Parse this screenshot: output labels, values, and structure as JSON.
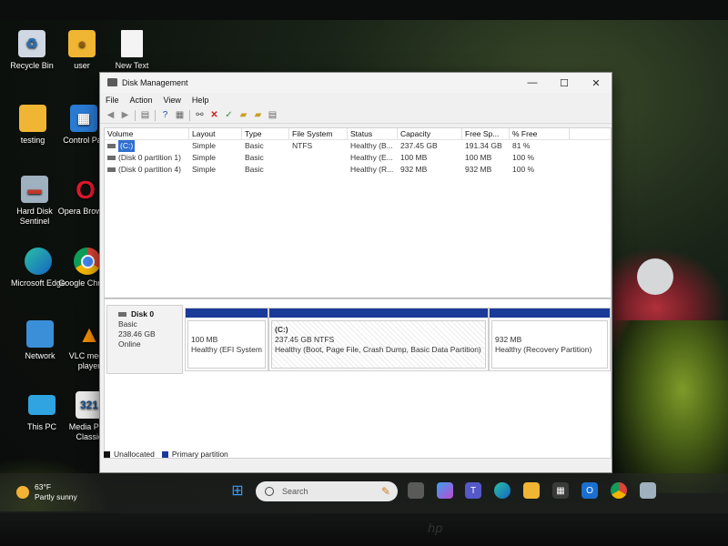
{
  "desktop": {
    "icons": [
      {
        "label": "Recycle Bin",
        "icon": "recycle-bin-icon"
      },
      {
        "label": "user",
        "icon": "folder-icon"
      },
      {
        "label": "New Text",
        "icon": "document-icon"
      },
      {
        "label": "testing",
        "icon": "folder-icon"
      },
      {
        "label": "Control Par",
        "icon": "control-panel-icon"
      },
      {
        "label": "Hard Disk Sentinel",
        "icon": "hard-disk-sentinel-icon"
      },
      {
        "label": "Opera Browser",
        "icon": "opera-icon"
      },
      {
        "label": "Microsoft Edge",
        "icon": "edge-icon"
      },
      {
        "label": "Google Chrome",
        "icon": "chrome-icon"
      },
      {
        "label": "Network",
        "icon": "network-icon"
      },
      {
        "label": "VLC media player",
        "icon": "vlc-icon"
      },
      {
        "label": "This PC",
        "icon": "this-pc-icon"
      },
      {
        "label": "Media Play Classic",
        "icon": "media-player-classic-icon"
      }
    ]
  },
  "window": {
    "title": "Disk Management",
    "menu": [
      "File",
      "Action",
      "View",
      "Help"
    ],
    "columns": [
      "Volume",
      "Layout",
      "Type",
      "File System",
      "Status",
      "Capacity",
      "Free Sp...",
      "% Free"
    ],
    "volumes": [
      {
        "name": "(C:)",
        "layout": "Simple",
        "type": "Basic",
        "fs": "NTFS",
        "status": "Healthy (B...",
        "capacity": "237.45 GB",
        "free": "191.34 GB",
        "pct": "81 %"
      },
      {
        "name": "(Disk 0 partition 1)",
        "layout": "Simple",
        "type": "Basic",
        "fs": "",
        "status": "Healthy (E...",
        "capacity": "100 MB",
        "free": "100 MB",
        "pct": "100 %"
      },
      {
        "name": "(Disk 0 partition 4)",
        "layout": "Simple",
        "type": "Basic",
        "fs": "",
        "status": "Healthy (R...",
        "capacity": "932 MB",
        "free": "932 MB",
        "pct": "100 %"
      }
    ],
    "disk": {
      "name": "Disk 0",
      "type": "Basic",
      "size": "238.46 GB",
      "state": "Online",
      "partitions": [
        {
          "title": "",
          "size": "100 MB",
          "status": "Healthy (EFI System"
        },
        {
          "title": "(C:)",
          "size": "237.45 GB NTFS",
          "status": "Healthy (Boot, Page File, Crash Dump, Basic Data Partition)"
        },
        {
          "title": "",
          "size": "932 MB",
          "status": "Healthy (Recovery Partition)"
        }
      ]
    },
    "legend": {
      "unallocated": "Unallocated",
      "primary": "Primary partition"
    }
  },
  "taskbar": {
    "weather_temp": "63°F",
    "weather_desc": "Partly sunny",
    "search_placeholder": "Search"
  },
  "colors": {
    "primary_partition": "#1a3a9a",
    "unallocated": "#111111",
    "selection": "#2f6fd0"
  }
}
